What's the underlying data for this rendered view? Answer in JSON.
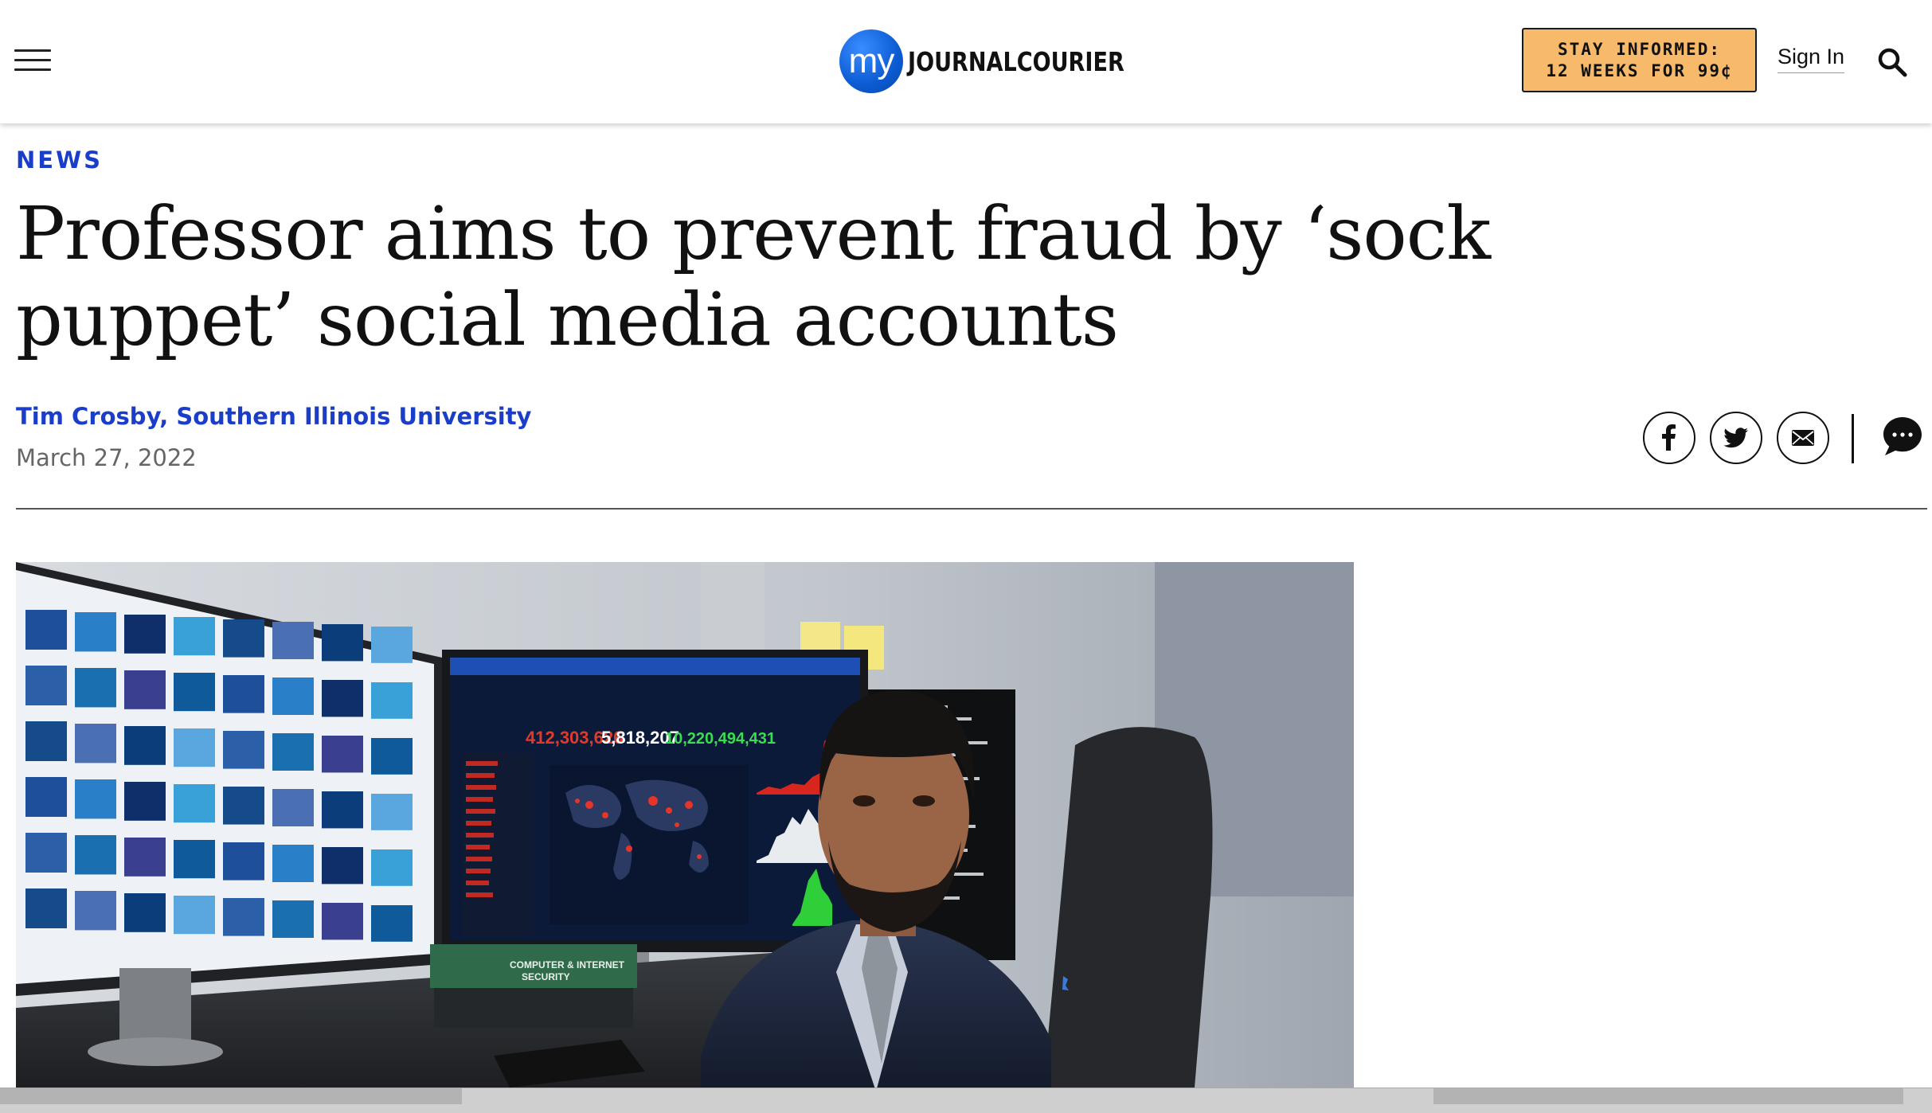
{
  "header": {
    "menu_icon": "hamburger-menu-icon",
    "logo": {
      "prefix": "my",
      "name": "JOURNALCOURIER",
      "brand_color": "#0b5bd3"
    },
    "cta": {
      "line1": "STAY INFORMED:",
      "line2": "12 WEEKS FOR 99¢",
      "background": "#f7b96a"
    },
    "sign_in": "Sign In",
    "search_icon": "search-icon"
  },
  "article": {
    "category": "NEWS",
    "headline": "Professor aims to prevent fraud by ‘sock puppet’ social media accounts",
    "byline": "Tim Crosby, Southern Illinois University",
    "date": "March 27, 2022",
    "accent_color": "#1a3ec9"
  },
  "share": {
    "facebook_icon": "facebook-icon",
    "twitter_icon": "twitter-icon",
    "email_icon": "email-icon",
    "comments_icon": "comment-icon"
  },
  "photo": {
    "book_title_line1": "COMPUTER & INTERNET",
    "book_title_line2": "SECURITY",
    "dashboard_numbers": [
      "412,303,626",
      "5,818,207",
      "10,220,494,431"
    ]
  }
}
